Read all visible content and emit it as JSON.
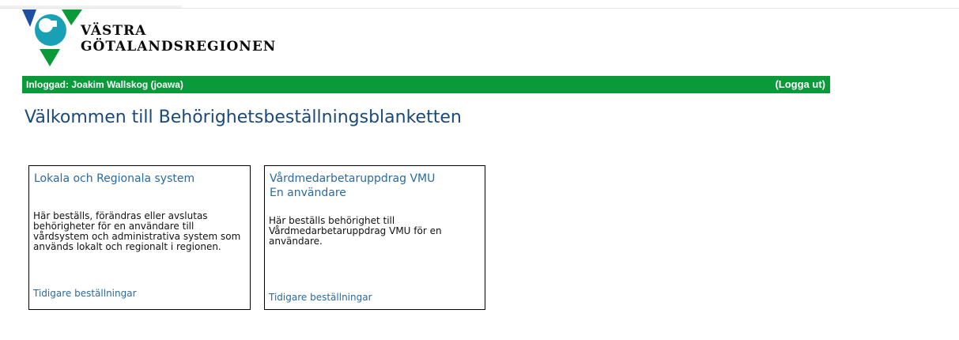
{
  "header": {
    "logo": {
      "line1": "VÄSTRA",
      "line2": "GÖTALANDSREGIONEN"
    },
    "user_status": "Inloggad: Joakim Wallskog (joawa)",
    "logout_label": "(Logga ut)",
    "bar_color": "#0a9a3a"
  },
  "main": {
    "title": "Välkommen till Behörighetsbeställningsblanketten",
    "cards": [
      {
        "title_lines": [
          "Lokala och Regionala system"
        ],
        "description": "Här beställs, förändras eller avslutas behörigheter för en användare till vårdsystem och administrativa system som används lokalt och regionalt i regionen.",
        "link": "Tidigare beställningar"
      },
      {
        "title_lines": [
          "Vårdmedarbetaruppdrag VMU",
          "En användare"
        ],
        "description": "Här beställs behörighet till Vårdmedarbetaruppdrag VMU för en användare.",
        "link": "Tidigare beställningar"
      }
    ]
  },
  "colors": {
    "title": "#1a4a7a",
    "link": "#2a6aa0",
    "logo_blue": "#1f4fa0",
    "logo_green": "#0a9a3a",
    "logo_teal": "#1aa0b4"
  }
}
